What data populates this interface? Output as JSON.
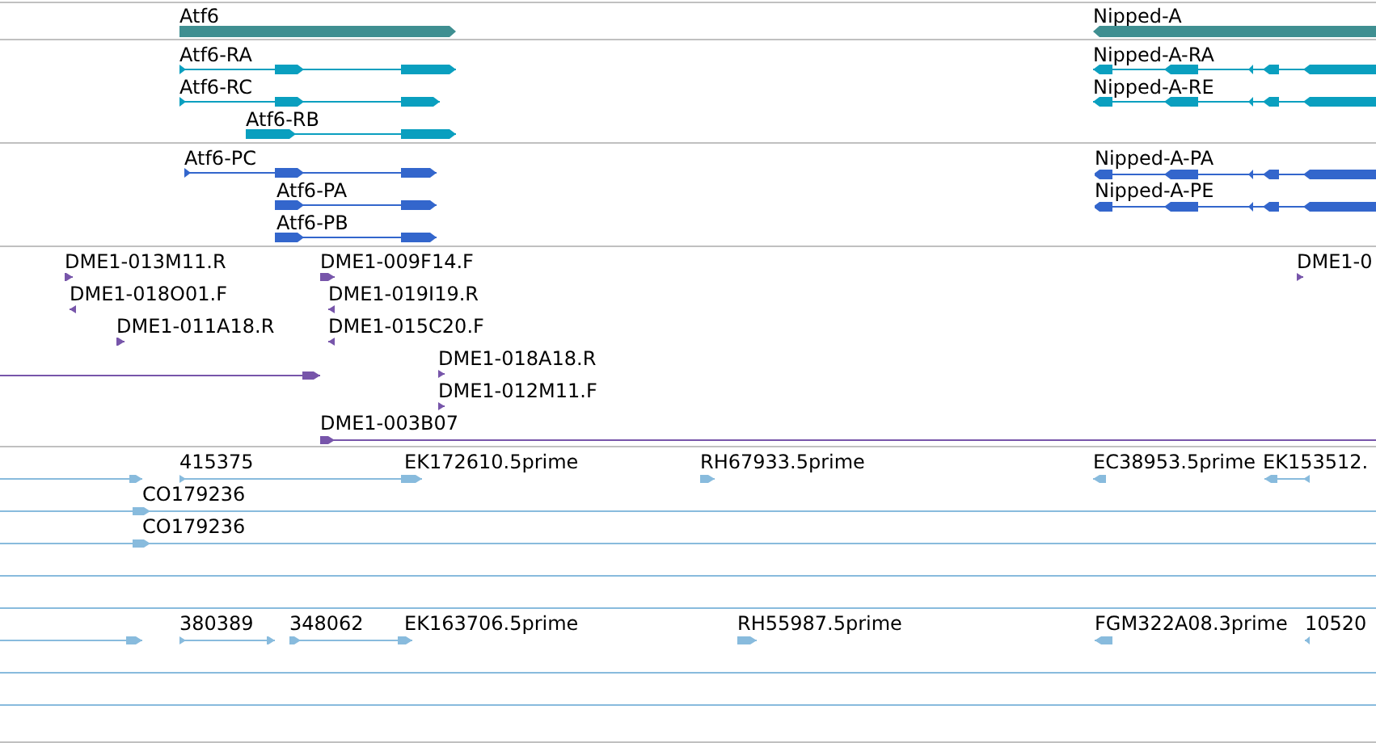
{
  "tracks": [
    {
      "kind": "gene",
      "features": [
        {
          "label": "Atf6",
          "reverse": false
        },
        {
          "label": "Nipped-A",
          "reverse": true
        }
      ]
    },
    {
      "kind": "transcript",
      "features": [
        {
          "label": "Atf6-RA",
          "reverse": false
        },
        {
          "label": "Atf6-RC",
          "reverse": false
        },
        {
          "label": "Atf6-RB",
          "reverse": false
        },
        {
          "label": "Nipped-A-RA",
          "reverse": true
        },
        {
          "label": "Nipped-A-RE",
          "reverse": true
        }
      ]
    },
    {
      "kind": "protein",
      "features": [
        {
          "label": "Atf6-PC",
          "reverse": false
        },
        {
          "label": "Atf6-PA",
          "reverse": false
        },
        {
          "label": "Atf6-PB",
          "reverse": false
        },
        {
          "label": "Nipped-A-PA",
          "reverse": true
        },
        {
          "label": "Nipped-A-PE",
          "reverse": true
        }
      ]
    },
    {
      "kind": "clone",
      "features": [
        {
          "label": "DME1-013M11.R",
          "reverse": false
        },
        {
          "label": "DME1-018O01.F",
          "reverse": true
        },
        {
          "label": "DME1-011A18.R",
          "reverse": false
        },
        {
          "label": "DME1-009F14.F",
          "reverse": false
        },
        {
          "label": "DME1-019I19.R",
          "reverse": true
        },
        {
          "label": "DME1-015C20.F",
          "reverse": true
        },
        {
          "label": "DME1-018A18.R",
          "reverse": false
        },
        {
          "label": "DME1-012M11.F",
          "reverse": false
        },
        {
          "label": "DME1-003B07",
          "reverse": false
        },
        {
          "label": "DME1-0",
          "reverse": false
        }
      ]
    },
    {
      "kind": "est",
      "features": [
        {
          "label": "415375",
          "reverse": false
        },
        {
          "label": "EK172610.5prime",
          "reverse": false
        },
        {
          "label": "RH67933.5prime",
          "reverse": false
        },
        {
          "label": "EC38953.5prime",
          "reverse": true
        },
        {
          "label": "EK153512.",
          "reverse": true
        },
        {
          "label": "CO179236",
          "reverse": false
        },
        {
          "label": "CO179236",
          "reverse": false
        },
        {
          "label": "380389",
          "reverse": false
        },
        {
          "label": "348062",
          "reverse": false
        },
        {
          "label": "EK163706.5prime",
          "reverse": false
        },
        {
          "label": "RH55987.5prime",
          "reverse": false
        },
        {
          "label": "FGM322A08.3prime",
          "reverse": true
        },
        {
          "label": "10520",
          "reverse": true
        }
      ]
    }
  ]
}
